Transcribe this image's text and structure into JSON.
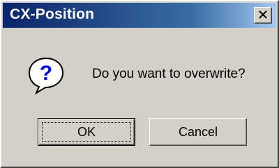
{
  "window": {
    "title": "CX-Position",
    "close_icon": "close-icon"
  },
  "dialog": {
    "icon": "question-icon",
    "message": "Do you want to overwrite?"
  },
  "buttons": {
    "ok_label": "OK",
    "cancel_label": "Cancel"
  },
  "colors": {
    "titlebar_start": "#0a246a",
    "titlebar_end": "#a6caf0",
    "dialog_bg": "#d4d0c8"
  }
}
